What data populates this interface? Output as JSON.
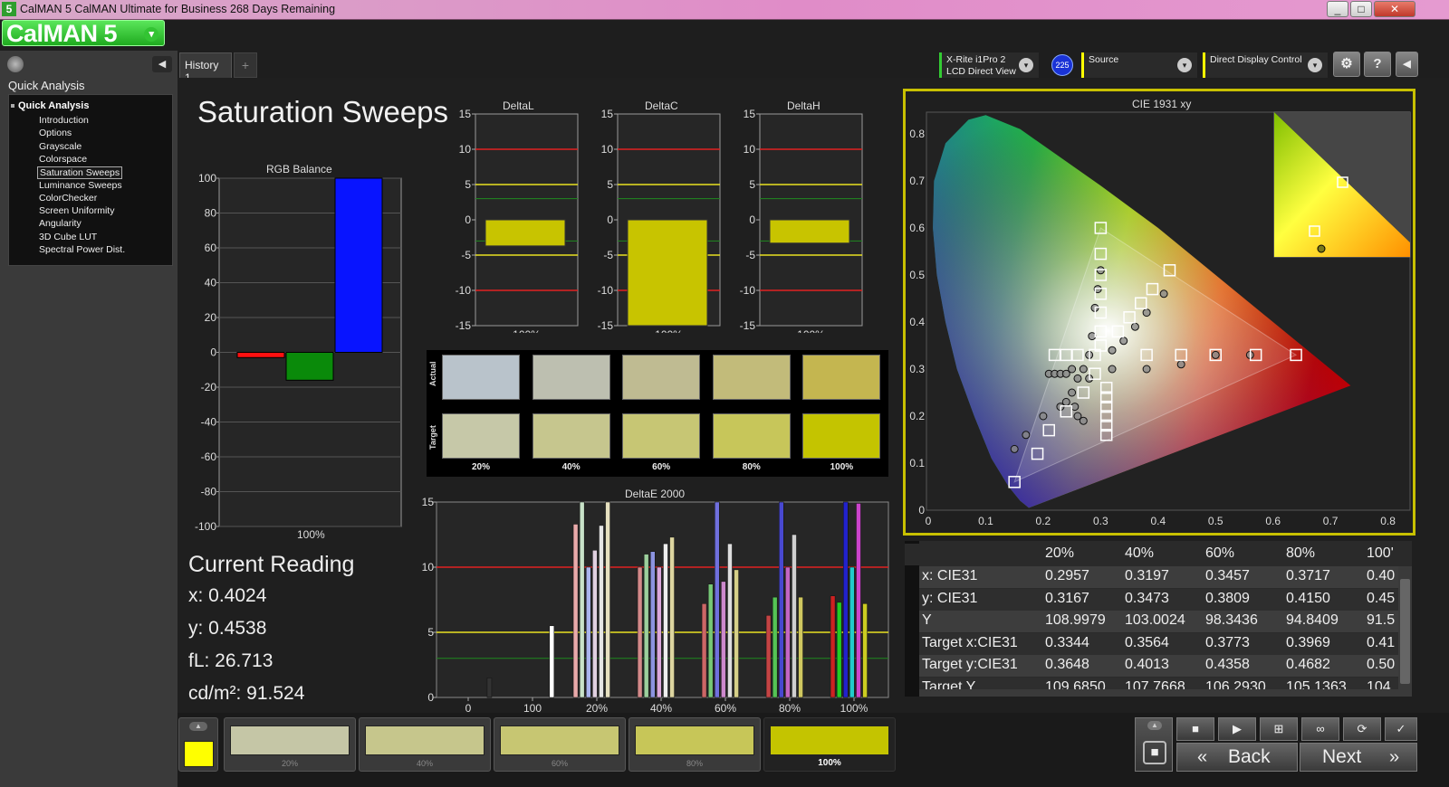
{
  "window": {
    "title": "CalMAN 5 CalMAN Ultimate for Business 268 Days Remaining",
    "logo": "5",
    "minimize": "_",
    "maximize": "□",
    "close": "✕"
  },
  "brand": {
    "label": "CalMAN 5",
    "dropdown": "▾"
  },
  "sidebar": {
    "heading": "Quick Analysis",
    "collapse": "◀",
    "root": "Quick Analysis",
    "items": [
      "Introduction",
      "Options",
      "Grayscale",
      "Colorspace",
      "Saturation Sweeps",
      "Luminance Sweeps",
      "ColorChecker",
      "Screen Uniformity",
      "Angularity",
      "3D Cube LUT",
      "Spectral Power Dist."
    ],
    "selected_index": 4
  },
  "tabs": {
    "history": "History 1",
    "add": "+"
  },
  "devices": {
    "meter_line1": "X-Rite i1Pro 2",
    "meter_line2": "LCD Direct View",
    "meter_badge": "225",
    "source": "Source",
    "display": "Direct Display Control",
    "settings_icon": "⚙",
    "help_icon": "?",
    "collapse_icon": "◀"
  },
  "page_title": "Saturation Sweeps",
  "rgb_chart": {
    "title": "RGB Balance",
    "xlabel": "100%",
    "yticks": [
      "100",
      "80",
      "60",
      "40",
      "20",
      "0",
      "-20",
      "-40",
      "-60",
      "-80",
      "-100"
    ]
  },
  "delta_charts": [
    {
      "title": "DeltaL",
      "xlabel": "100%"
    },
    {
      "title": "DeltaC",
      "xlabel": "100%"
    },
    {
      "title": "DeltaH",
      "xlabel": "100%"
    }
  ],
  "delta_yticks": [
    "15",
    "10",
    "5",
    "0",
    "-5",
    "-10",
    "-15"
  ],
  "swatch_grid": {
    "row_labels": [
      "Actual",
      "Target"
    ],
    "columns": [
      "20%",
      "40%",
      "60%",
      "80%",
      "100%"
    ],
    "actual_colors": [
      "#b9c3cb",
      "#bdbfb0",
      "#bfbb92",
      "#c2bb7a",
      "#c4b650"
    ],
    "target_colors": [
      "#c6c8a8",
      "#c6c68e",
      "#c7c674",
      "#c7c65a",
      "#c4c400"
    ]
  },
  "deltae_chart": {
    "title": "DeltaE 2000",
    "yticks": [
      "15",
      "10",
      "5",
      "0"
    ],
    "xticks": [
      "0",
      "100",
      "20%",
      "40%",
      "60%",
      "80%",
      "100%"
    ]
  },
  "cie_chart": {
    "title": "CIE 1931 xy",
    "xticks": [
      "0",
      "0.1",
      "0.2",
      "0.3",
      "0.4",
      "0.5",
      "0.6",
      "0.7",
      "0.8"
    ],
    "yticks": [
      "0.8",
      "0.7",
      "0.6",
      "0.5",
      "0.4",
      "0.3",
      "0.2",
      "0.1",
      "0"
    ]
  },
  "current_reading": {
    "heading": "Current Reading",
    "x": "x: 0.4024",
    "y": "y: 0.4538",
    "fl": "fL: 26.713",
    "cdm2": "cd/m²: 91.524"
  },
  "table": {
    "columns": [
      "20%",
      "40%",
      "60%",
      "80%",
      "100'"
    ],
    "rows": [
      {
        "label": "x: CIE31",
        "values": [
          "0.2957",
          "0.3197",
          "0.3457",
          "0.3717",
          "0.40"
        ]
      },
      {
        "label": "y: CIE31",
        "values": [
          "0.3167",
          "0.3473",
          "0.3809",
          "0.4150",
          "0.45"
        ]
      },
      {
        "label": "Y",
        "values": [
          "108.9979",
          "103.0024",
          "98.3436",
          "94.8409",
          "91.5"
        ]
      },
      {
        "label": "Target x:CIE31",
        "values": [
          "0.3344",
          "0.3564",
          "0.3773",
          "0.3969",
          "0.41"
        ]
      },
      {
        "label": "Target y:CIE31",
        "values": [
          "0.3648",
          "0.4013",
          "0.4358",
          "0.4682",
          "0.50"
        ]
      },
      {
        "label": "Target Y",
        "values": [
          "109.6850",
          "107.7668",
          "106.2930",
          "105.1363",
          "104"
        ]
      }
    ]
  },
  "bottom": {
    "swatch_labels": [
      "20%",
      "40%",
      "60%",
      "80%",
      "100%"
    ],
    "swatch_colors": [
      "#c5c6a6",
      "#c6c68c",
      "#c7c672",
      "#c7c658",
      "#c4c400"
    ],
    "current_color": "#ffff00",
    "back": "Back",
    "next": "Next",
    "stop_icon": "■",
    "play_icon": "▶",
    "fit_icon": "⊞",
    "loop_icon": "∞",
    "refresh_icon": "⟳",
    "check_icon": "✓",
    "back_arrows": "«",
    "next_arrows": "»"
  },
  "chart_data": [
    {
      "type": "bar",
      "title": "RGB Balance",
      "categories": [
        "100%"
      ],
      "series": [],
      "values": {
        "red": -3,
        "green": -16,
        "blue": 100
      },
      "ylim": [
        -100,
        100
      ]
    },
    {
      "type": "bar",
      "title": "DeltaL",
      "categories": [
        "100%"
      ],
      "values": [
        -3.7
      ],
      "ylim": [
        -15,
        15
      ],
      "reference_lines": [
        10,
        5,
        3,
        -3,
        -5,
        -10
      ]
    },
    {
      "type": "bar",
      "title": "DeltaC",
      "categories": [
        "100%"
      ],
      "values": [
        -15
      ],
      "ylim": [
        -15,
        15
      ],
      "reference_lines": [
        10,
        5,
        3,
        -3,
        -5,
        -10
      ]
    },
    {
      "type": "bar",
      "title": "DeltaH",
      "categories": [
        "100%"
      ],
      "values": [
        -3.3
      ],
      "ylim": [
        -15,
        15
      ],
      "reference_lines": [
        10,
        5,
        3,
        -3,
        -5,
        -10
      ]
    },
    {
      "type": "bar",
      "title": "DeltaE 2000",
      "ylim": [
        0,
        15
      ],
      "reference_lines": [
        10,
        5,
        3
      ],
      "bars": [
        {
          "x": 0.33,
          "v": 1.5,
          "c": "#333333"
        },
        {
          "x": 1.3,
          "v": 5.5,
          "c": "#ffffff"
        },
        {
          "x": 1.67,
          "v": 13.3,
          "c": "#e9aaaa"
        },
        {
          "x": 1.77,
          "v": 15,
          "c": "#c8e2c8"
        },
        {
          "x": 1.87,
          "v": 10,
          "c": "#aab4ee"
        },
        {
          "x": 1.97,
          "v": 11.3,
          "c": "#e0d0e0"
        },
        {
          "x": 2.07,
          "v": 13.2,
          "c": "#e5e5e5"
        },
        {
          "x": 2.17,
          "v": 15,
          "c": "#e6e0c0"
        },
        {
          "x": 2.67,
          "v": 10,
          "c": "#d48a8a"
        },
        {
          "x": 2.77,
          "v": 11,
          "c": "#9ccf9c"
        },
        {
          "x": 2.87,
          "v": 11.2,
          "c": "#8c93e0"
        },
        {
          "x": 2.97,
          "v": 10,
          "c": "#dca8dc"
        },
        {
          "x": 3.07,
          "v": 11.8,
          "c": "#eeeeee"
        },
        {
          "x": 3.17,
          "v": 12.3,
          "c": "#ddd5a0"
        },
        {
          "x": 3.67,
          "v": 7.2,
          "c": "#cc6666"
        },
        {
          "x": 3.77,
          "v": 8.7,
          "c": "#77c877"
        },
        {
          "x": 3.87,
          "v": 15,
          "c": "#7070dd"
        },
        {
          "x": 3.97,
          "v": 8.9,
          "c": "#cc88cc"
        },
        {
          "x": 4.07,
          "v": 11.8,
          "c": "#dddddd"
        },
        {
          "x": 4.17,
          "v": 9.8,
          "c": "#d6d088"
        },
        {
          "x": 4.67,
          "v": 6.3,
          "c": "#c44444"
        },
        {
          "x": 4.77,
          "v": 7.7,
          "c": "#55c455"
        },
        {
          "x": 4.87,
          "v": 15,
          "c": "#4848d0"
        },
        {
          "x": 4.97,
          "v": 10,
          "c": "#c466c4"
        },
        {
          "x": 5.07,
          "v": 12.5,
          "c": "#cfcfcf"
        },
        {
          "x": 5.17,
          "v": 7.7,
          "c": "#cfc760"
        },
        {
          "x": 5.67,
          "v": 7.8,
          "c": "#cc2222"
        },
        {
          "x": 5.77,
          "v": 7.3,
          "c": "#22cc22"
        },
        {
          "x": 5.87,
          "v": 15,
          "c": "#2222cc"
        },
        {
          "x": 5.97,
          "v": 10,
          "c": "#22cccc"
        },
        {
          "x": 6.07,
          "v": 14.9,
          "c": "#cc44cc"
        },
        {
          "x": 6.17,
          "v": 7.2,
          "c": "#cccc22"
        }
      ]
    },
    {
      "type": "scatter",
      "title": "CIE 1931 xy",
      "xlim": [
        0,
        0.8
      ],
      "ylim": [
        0,
        0.85
      ],
      "gamut": [
        [
          0.64,
          0.33
        ],
        [
          0.3,
          0.6
        ],
        [
          0.15,
          0.06
        ]
      ],
      "targets": [
        [
          0.3,
          0.6
        ],
        [
          0.3,
          0.545
        ],
        [
          0.3,
          0.5
        ],
        [
          0.3,
          0.46
        ],
        [
          0.3,
          0.42
        ],
        [
          0.3,
          0.38
        ],
        [
          0.3,
          0.35
        ],
        [
          0.42,
          0.51
        ],
        [
          0.39,
          0.47
        ],
        [
          0.37,
          0.44
        ],
        [
          0.35,
          0.41
        ],
        [
          0.33,
          0.38
        ],
        [
          0.22,
          0.33
        ],
        [
          0.24,
          0.33
        ],
        [
          0.26,
          0.33
        ],
        [
          0.29,
          0.33
        ],
        [
          0.38,
          0.33
        ],
        [
          0.44,
          0.33
        ],
        [
          0.5,
          0.33
        ],
        [
          0.57,
          0.33
        ],
        [
          0.64,
          0.33
        ],
        [
          0.15,
          0.06
        ],
        [
          0.19,
          0.12
        ],
        [
          0.21,
          0.17
        ],
        [
          0.24,
          0.21
        ],
        [
          0.27,
          0.25
        ],
        [
          0.29,
          0.29
        ],
        [
          0.31,
          0.26
        ],
        [
          0.31,
          0.24
        ],
        [
          0.31,
          0.22
        ],
        [
          0.31,
          0.2
        ],
        [
          0.31,
          0.18
        ],
        [
          0.31,
          0.16
        ]
      ],
      "measured": [
        [
          0.3,
          0.51
        ],
        [
          0.295,
          0.47
        ],
        [
          0.29,
          0.43
        ],
        [
          0.285,
          0.37
        ],
        [
          0.28,
          0.33
        ],
        [
          0.41,
          0.46
        ],
        [
          0.38,
          0.42
        ],
        [
          0.36,
          0.39
        ],
        [
          0.34,
          0.36
        ],
        [
          0.32,
          0.34
        ],
        [
          0.21,
          0.29
        ],
        [
          0.22,
          0.29
        ],
        [
          0.23,
          0.29
        ],
        [
          0.24,
          0.29
        ],
        [
          0.25,
          0.3
        ],
        [
          0.27,
          0.3
        ],
        [
          0.32,
          0.3
        ],
        [
          0.38,
          0.3
        ],
        [
          0.44,
          0.31
        ],
        [
          0.5,
          0.33
        ],
        [
          0.56,
          0.33
        ],
        [
          0.15,
          0.13
        ],
        [
          0.17,
          0.16
        ],
        [
          0.2,
          0.2
        ],
        [
          0.23,
          0.22
        ],
        [
          0.25,
          0.25
        ],
        [
          0.28,
          0.28
        ],
        [
          0.27,
          0.19
        ],
        [
          0.26,
          0.2
        ],
        [
          0.24,
          0.23
        ],
        [
          0.255,
          0.22
        ],
        [
          0.26,
          0.28
        ]
      ]
    }
  ]
}
